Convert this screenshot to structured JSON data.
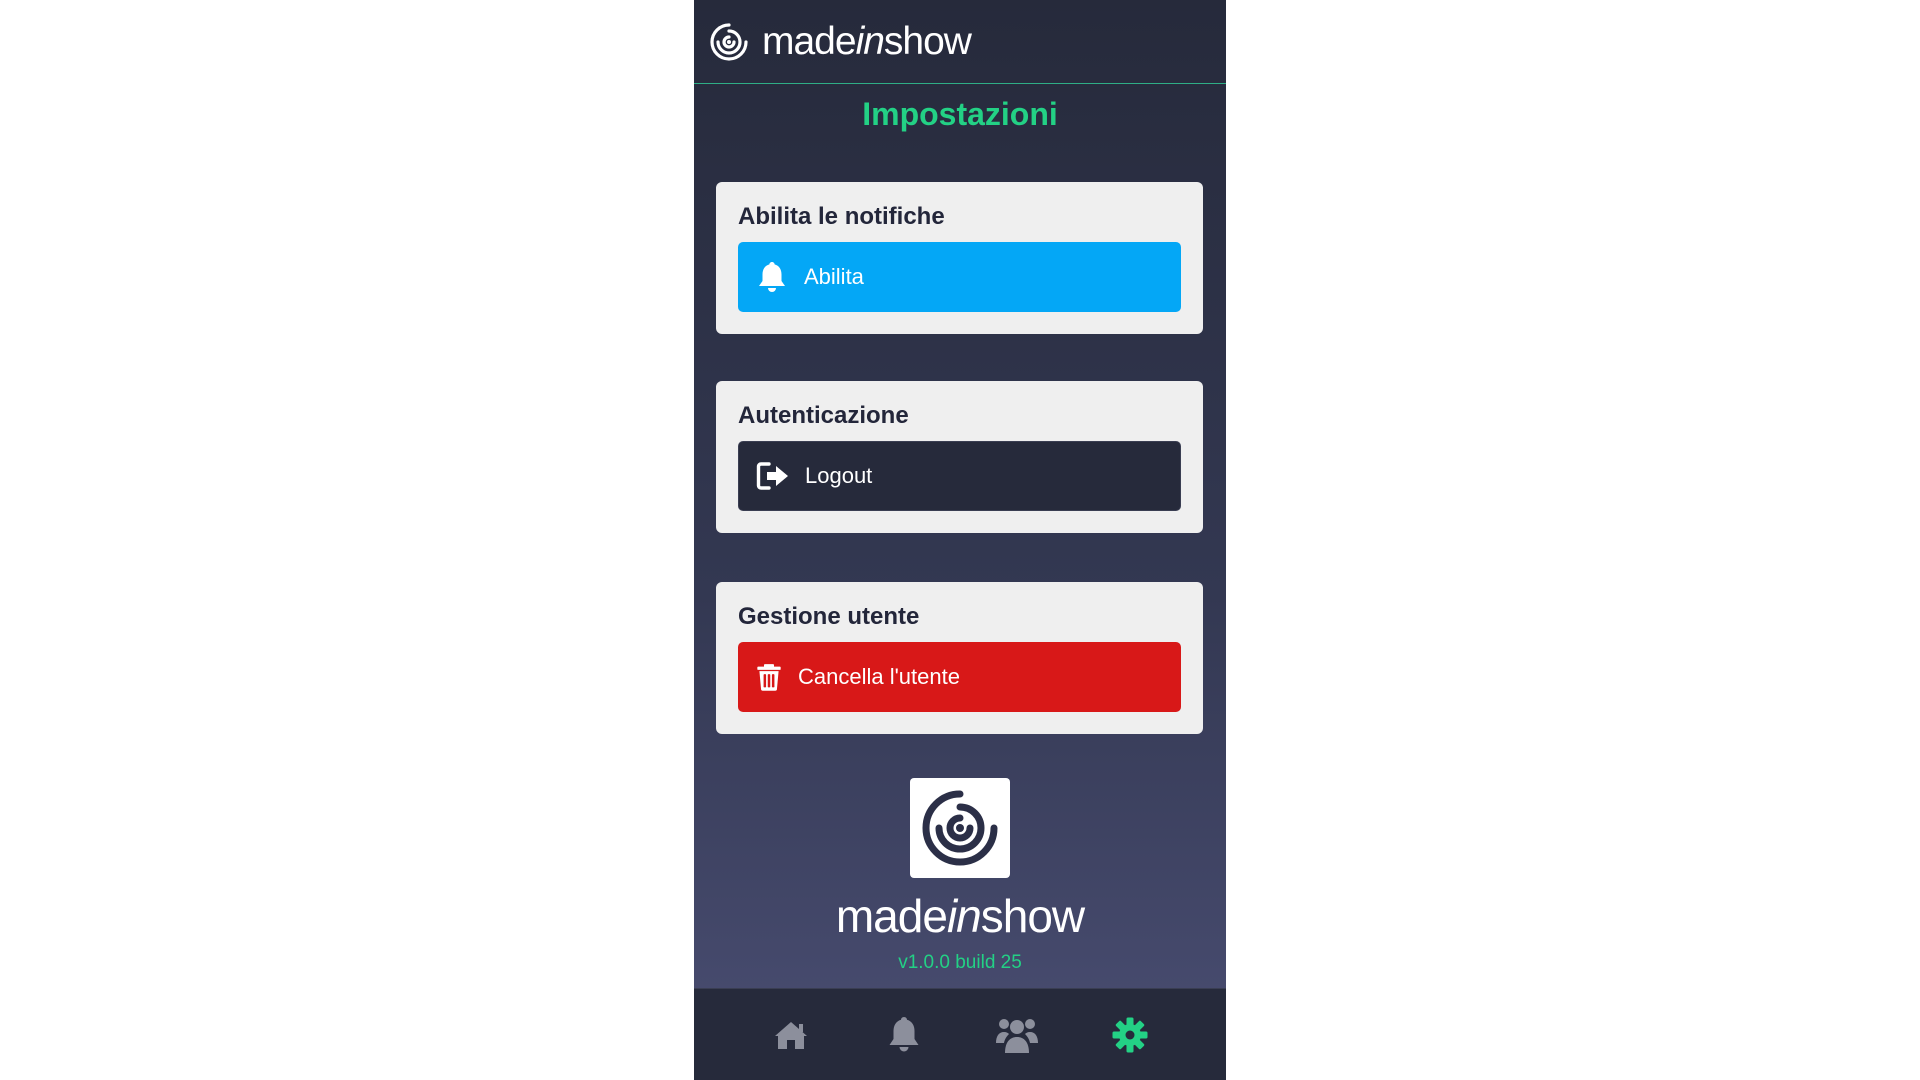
{
  "header": {
    "brand_prefix": "made",
    "brand_mid": "in",
    "brand_suffix": "show",
    "logo_icon": "target-swirl-icon"
  },
  "page": {
    "title": "Impostazioni"
  },
  "sections": {
    "notifications": {
      "title": "Abilita le notifiche",
      "button_label": "Abilita",
      "button_icon": "bell-icon",
      "button_color": "#04a7f6"
    },
    "auth": {
      "title": "Autenticazione",
      "button_label": "Logout",
      "button_icon": "logout-icon",
      "button_color": "#262a3b"
    },
    "user": {
      "title": "Gestione utente",
      "button_label": "Cancella l'utente",
      "button_icon": "trash-icon",
      "button_color": "#d81818"
    }
  },
  "footer": {
    "brand_prefix": "made",
    "brand_mid": "in",
    "brand_suffix": "show",
    "version": "v1.0.0 build 25"
  },
  "tabs": [
    {
      "icon": "home-icon",
      "active": false
    },
    {
      "icon": "bell-icon",
      "active": false
    },
    {
      "icon": "users-icon",
      "active": false
    },
    {
      "icon": "gear-icon",
      "active": true
    }
  ],
  "colors": {
    "accent": "#23d185",
    "inactive_tab": "#8c8f9c"
  }
}
